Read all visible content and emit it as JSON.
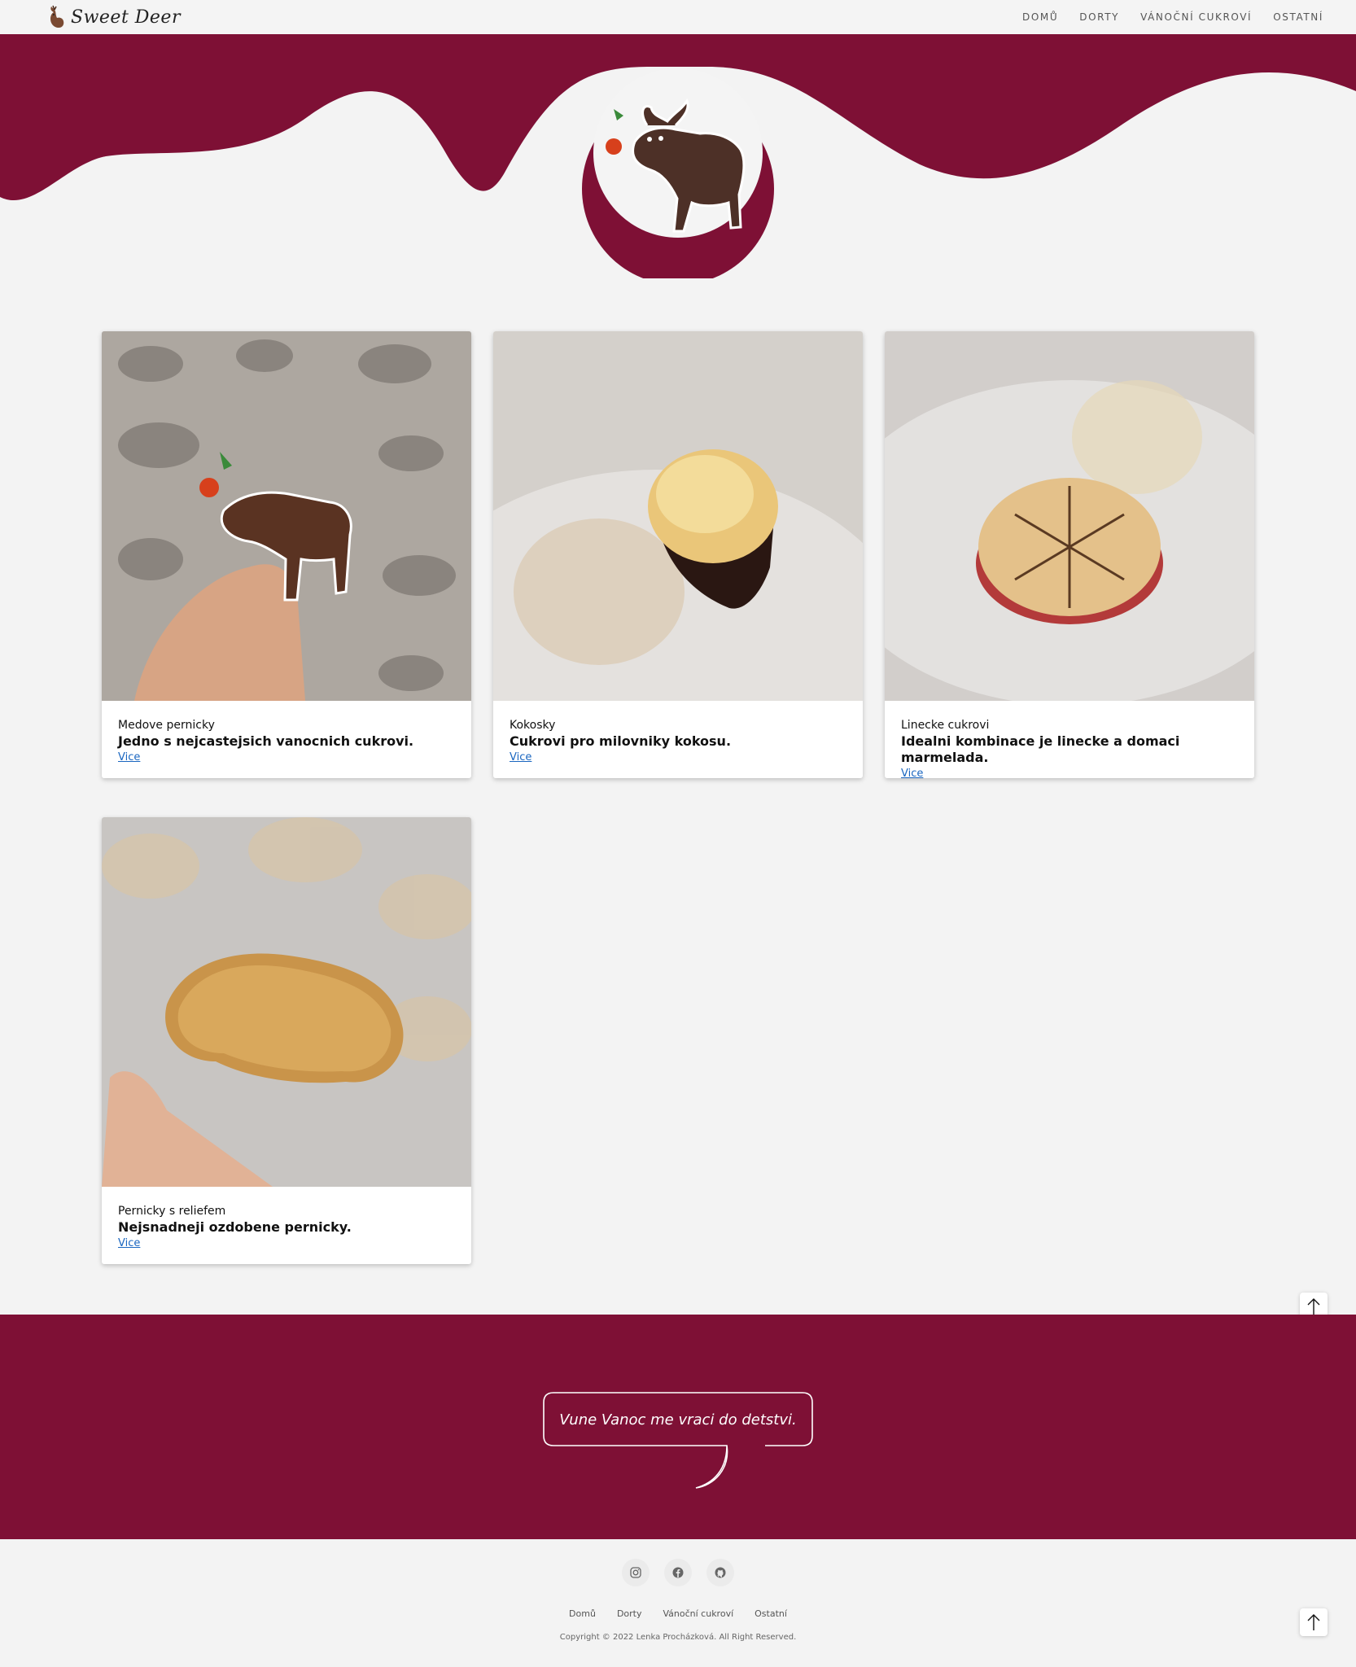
{
  "brand": {
    "name": "Sweet Deer"
  },
  "nav": {
    "items": [
      "DOMŮ",
      "DORTY",
      "VÁNOČNÍ CUKROVÍ",
      "OSTATNÍ"
    ]
  },
  "colors": {
    "accent": "#7e1035",
    "background": "#f3f3f3",
    "link": "#1a66c0"
  },
  "cards": [
    {
      "subtitle": "Medove pernicky",
      "title": "Jedno s nejcastejsich vanocnich cukrovi.",
      "link": "Vice",
      "image": "gingerbread-moose-photo"
    },
    {
      "subtitle": "Kokosky",
      "title": "Cukrovi pro milovniky kokosu.",
      "link": "Vice",
      "image": "coconut-macaroon-photo"
    },
    {
      "subtitle": "Linecke cukrovi",
      "title": "Idealni kombinace je linecke a domaci marmelada.",
      "link": "Vice",
      "image": "linzer-cookie-photo"
    },
    {
      "subtitle": "Pernicky s reliefem",
      "title": "Nejsnadneji ozdobene pernicky.",
      "link": "Vice",
      "image": "relief-gingerbread-photo"
    }
  ],
  "quote": {
    "text": "Vune Vanoc me vraci do detstvi."
  },
  "footer": {
    "social": [
      "instagram-icon",
      "facebook-icon",
      "github-icon"
    ],
    "links": [
      "Domů",
      "Dorty",
      "Vánoční cukroví",
      "Ostatní"
    ],
    "copyright": "Copyright © 2022 Lenka Procházková. All Right Reserved."
  }
}
